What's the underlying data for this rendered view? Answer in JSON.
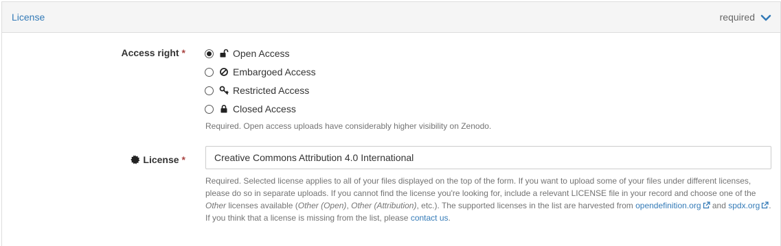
{
  "header": {
    "title": "License",
    "status": "required",
    "toggle_icon": "chevron-down-icon"
  },
  "access_right": {
    "label": "Access right",
    "required_mark": "*",
    "options": [
      {
        "label": "Open Access",
        "icon": "unlock-icon",
        "selected": true
      },
      {
        "label": "Embargoed Access",
        "icon": "ban-icon",
        "selected": false
      },
      {
        "label": "Restricted Access",
        "icon": "key-icon",
        "selected": false
      },
      {
        "label": "Closed Access",
        "icon": "lock-icon",
        "selected": false
      }
    ],
    "help": "Required. Open access uploads have considerably higher visibility on Zenodo."
  },
  "license": {
    "label": "License",
    "icon": "certificate-icon",
    "required_mark": "*",
    "value": "Creative Commons Attribution 4.0 International",
    "help": {
      "p1": "Required. Selected license applies to all of your files displayed on the top of the form. If you want to upload some of your files under different licenses, please do so in separate uploads. If you cannot find the license you're looking for, include a relevant LICENSE file in your record and choose one of the ",
      "other": "Other",
      "p2": " licenses available (",
      "other_open": "Other (Open)",
      "comma": ", ",
      "other_attribution": "Other (Attribution)",
      "p3": ", etc.). The supported licenses in the list are harvested from ",
      "link1": "opendefinition.org",
      "p4": " and ",
      "link2": "spdx.org",
      "p5": ". If you think that a license is missing from the list, please ",
      "link3": "contact us",
      "p6": "."
    }
  },
  "colors": {
    "link": "#337ab7",
    "required": "#a94442",
    "help_text": "#737373",
    "heading_bg": "#f5f5f5"
  }
}
